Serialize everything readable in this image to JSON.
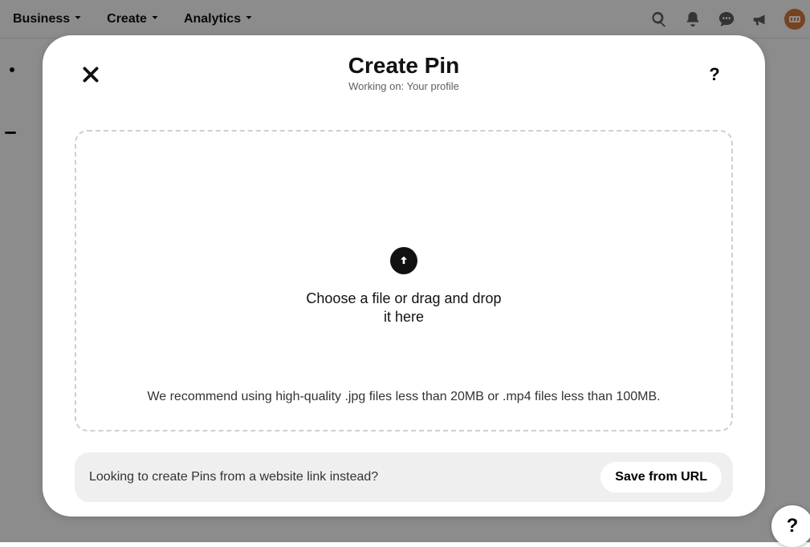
{
  "nav": {
    "items": [
      "Business",
      "Create",
      "Analytics"
    ]
  },
  "modal": {
    "title": "Create Pin",
    "subtitle": "Working on: Your profile",
    "dropzone": {
      "line1": "Choose a file or drag and drop",
      "line2": "it here",
      "recommendation": "We recommend using high-quality .jpg files less than 20MB or .mp4 files less than 100MB."
    },
    "urlBar": {
      "question": "Looking to create Pins from a website link instead?",
      "button": "Save from URL"
    }
  },
  "floatingHelp": "?",
  "headerHelp": "?"
}
